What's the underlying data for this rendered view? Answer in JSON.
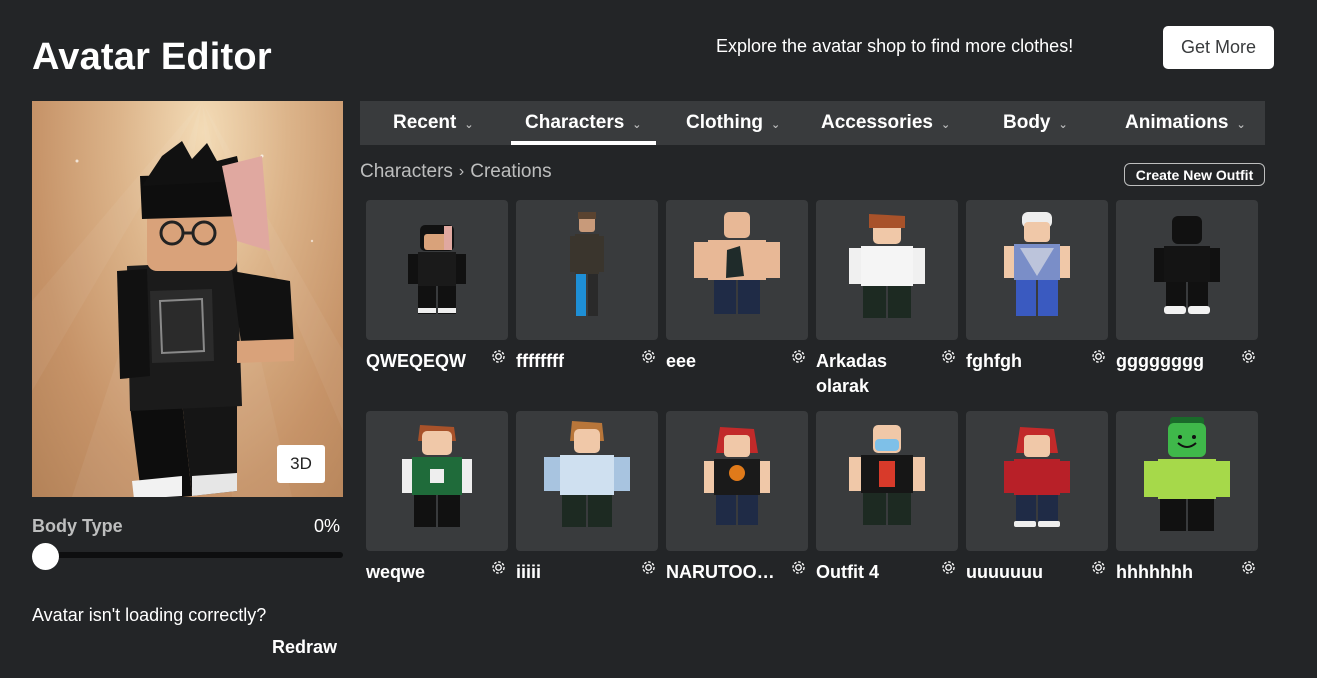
{
  "header": {
    "title": "Avatar Editor",
    "promo_text": "Explore the avatar shop to find more clothes!",
    "get_more_label": "Get More"
  },
  "preview": {
    "view_toggle_label": "3D",
    "body_type_label": "Body Type",
    "body_type_value": "0%",
    "body_type_fraction": 0,
    "help_text": "Avatar isn't loading correctly?",
    "redraw_label": "Redraw"
  },
  "tabs": [
    {
      "label": "Recent",
      "active": false
    },
    {
      "label": "Characters",
      "active": true
    },
    {
      "label": "Clothing",
      "active": false
    },
    {
      "label": "Accessories",
      "active": false
    },
    {
      "label": "Body",
      "active": false
    },
    {
      "label": "Animations",
      "active": false
    }
  ],
  "breadcrumb": {
    "parent": "Characters",
    "current": "Creations"
  },
  "create_new_outfit_label": "Create New Outfit",
  "outfits": [
    {
      "name": "QWEQEQW"
    },
    {
      "name": "ffffffff"
    },
    {
      "name": "eee"
    },
    {
      "name": "Arkadas olarak"
    },
    {
      "name": "fghfgh"
    },
    {
      "name": "gggggggg"
    },
    {
      "name": "weqwe"
    },
    {
      "name": "iiiii"
    },
    {
      "name": "NARUTOOOO"
    },
    {
      "name": "Outfit 4"
    },
    {
      "name": "uuuuuuu"
    },
    {
      "name": "hhhhhhh"
    }
  ],
  "icons": {
    "settings": "gear-icon",
    "dropdown": "chevron-down-icon",
    "breadcrumb_separator": "chevron-right-icon"
  },
  "colors": {
    "background": "#232527",
    "panel": "#393b3d",
    "text_secondary": "#bdbebe"
  }
}
